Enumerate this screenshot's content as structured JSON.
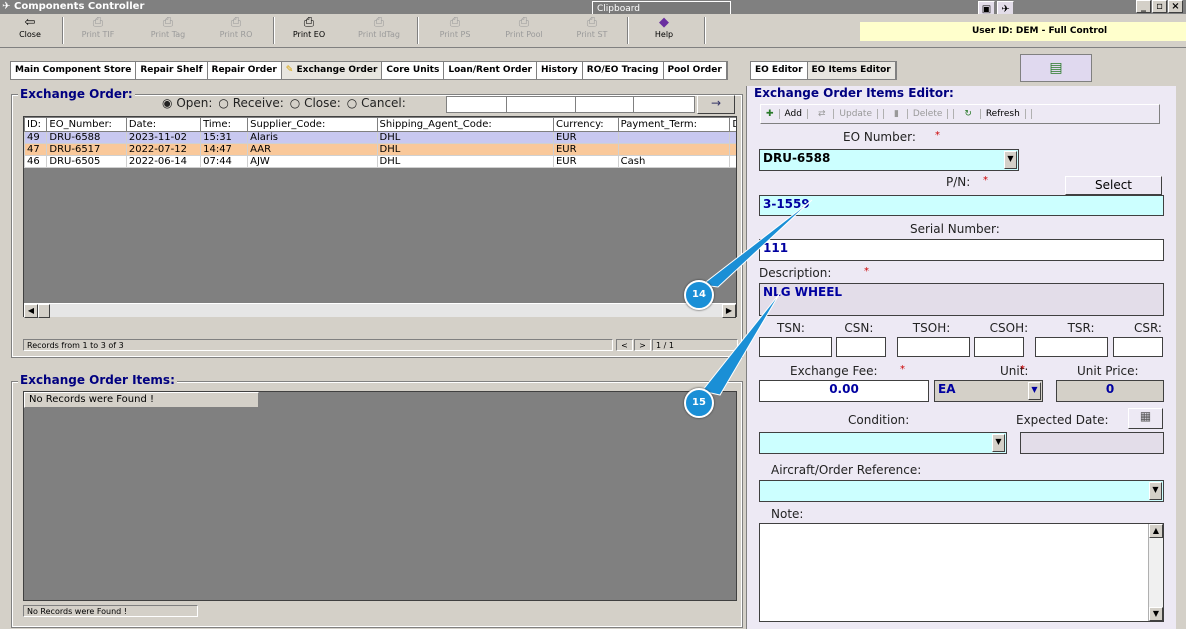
{
  "window": {
    "title": "Components Controller",
    "clipboard": "Clipboard",
    "min": "_",
    "max": "▫",
    "close": "×"
  },
  "toolbar": [
    {
      "label": "Close",
      "icon": "door-icon",
      "enabled": true
    },
    {
      "label": "Print TIF",
      "icon": "printer-icon",
      "enabled": false
    },
    {
      "label": "Print Tag",
      "icon": "printer-icon",
      "enabled": false
    },
    {
      "label": "Print RO",
      "icon": "printer-icon",
      "enabled": false
    },
    {
      "label": "Print EO",
      "icon": "printer-icon",
      "enabled": true
    },
    {
      "label": "Print IdTag",
      "icon": "printer-icon",
      "enabled": false
    },
    {
      "label": "Print PS",
      "icon": "printer-icon",
      "enabled": false
    },
    {
      "label": "Print Pool",
      "icon": "printer-icon",
      "enabled": false
    },
    {
      "label": "Print ST",
      "icon": "printer-icon",
      "enabled": false
    },
    {
      "label": "Help",
      "icon": "help-icon",
      "enabled": true
    }
  ],
  "user": "User ID: DEM - Full Control",
  "tabs": [
    "Main Component Store",
    "Repair Shelf",
    "Repair Order",
    "Exchange Order",
    "Core Units",
    "Loan/Rent Order",
    "History",
    "RO/EO Tracing",
    "Pool Order"
  ],
  "selected_tab": "Exchange Order",
  "editor_tabs": [
    "EO Editor",
    "EO Items Editor"
  ],
  "eo": {
    "title": "Exchange Order:",
    "radios": [
      "Open:",
      "Receive:",
      "Close:",
      "Cancel:"
    ],
    "selected_radio": "Open:",
    "go": "→",
    "columns": [
      "ID:",
      "EO_Number:",
      "Date:",
      "Time:",
      "Supplier_Code:",
      "Shipping_Agent_Code:",
      "Currency:",
      "Payment_Term:",
      "De"
    ],
    "rows": [
      [
        "49",
        "DRU-6588",
        "2023-11-02",
        "15:31",
        "Alaris",
        "DHL",
        "EUR",
        "",
        ""
      ],
      [
        "47",
        "DRU-6517",
        "2022-07-12",
        "14:47",
        "AAR",
        "DHL",
        "EUR",
        "",
        ""
      ],
      [
        "46",
        "DRU-6505",
        "2022-06-14",
        "07:44",
        "AJW",
        "DHL",
        "EUR",
        "Cash",
        ""
      ]
    ],
    "row_colors": [
      "#c8c8f0",
      "#f9c89a",
      "#ffffff"
    ],
    "records": "Records from 1 to 3 of 3",
    "pager_prev": "<",
    "pager_next": ">",
    "page": "1 / 1"
  },
  "items": {
    "title": "Exchange Order Items:",
    "header": "No Records were Found !",
    "status": "No Records were Found !"
  },
  "editor": {
    "title": "Exchange Order Items Editor:",
    "toolbar": {
      "add": "Add",
      "update": "Update",
      "delete": "Delete",
      "refresh": "Refresh"
    },
    "eo_number_label": "EO Number:",
    "eo_number": "DRU-6588",
    "pn_label": "P/N:",
    "select": "Select",
    "pn": "3-1559",
    "serial_label": "Serial Number:",
    "serial": "111",
    "desc_label": "Description:",
    "desc": "NLG WHEEL",
    "counters": [
      "TSN:",
      "CSN:",
      "TSOH:",
      "CSOH:",
      "TSR:",
      "CSR:"
    ],
    "fee_label": "Exchange Fee:",
    "fee": "0.00",
    "unit_label": "Unit:",
    "unit": "EA",
    "price_label": "Unit Price:",
    "price": "0",
    "condition_label": "Condition:",
    "date_label": "Expected Date:",
    "ref_label": "Aircraft/Order Reference:",
    "note_label": "Note:",
    "required": "*"
  },
  "callouts": [
    "14",
    "15"
  ],
  "accent": "#000080"
}
